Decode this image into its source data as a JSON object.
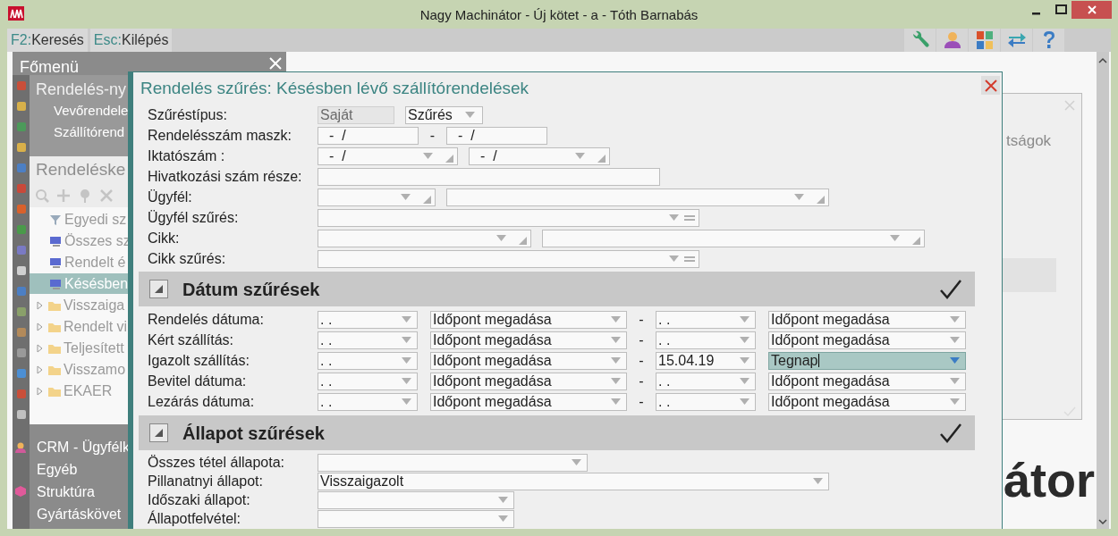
{
  "window": {
    "title": "Nagy Machinátor - Új kötet - a - Tóth Barnabás"
  },
  "toolbar": {
    "shortcuts": [
      {
        "key": "F2:",
        "label": "Keresés"
      },
      {
        "key": "Esc:",
        "label": "Kilépés"
      }
    ]
  },
  "main_menu": {
    "title": "Főmenü",
    "group": "Rendelés-ny",
    "group_items": [
      "Vevőrendele",
      "Szállítórend"
    ],
    "items": [
      "CRM - Ügyfélk",
      "Egyéb",
      "Struktúra",
      "Gyártáskövet"
    ]
  },
  "list_panel": {
    "title": "Rendeléske",
    "items": [
      {
        "label": "Egyedi sz",
        "kind": "filter",
        "selected": false
      },
      {
        "label": "Összes sz",
        "kind": "query",
        "selected": false
      },
      {
        "label": "Rendelt é",
        "kind": "query",
        "selected": false
      },
      {
        "label": "Késésben",
        "kind": "query",
        "selected": true
      },
      {
        "label": "Visszaiga",
        "kind": "folder",
        "selected": false,
        "expanded": false
      },
      {
        "label": "Rendelt vi",
        "kind": "folder",
        "selected": false,
        "expanded": false
      },
      {
        "label": "Teljesített",
        "kind": "folder",
        "selected": false,
        "expanded": false
      },
      {
        "label": "Visszamo",
        "kind": "folder",
        "selected": false,
        "expanded": false
      },
      {
        "label": "EKAER",
        "kind": "folder",
        "selected": false,
        "expanded": false
      }
    ]
  },
  "dialog": {
    "title": "Rendelés szűrés: Késésben lévő szállítórendelések",
    "rows": [
      {
        "label": "Szűréstípus:",
        "fields": [
          {
            "kind": "readonly",
            "value": "Saját"
          },
          {
            "kind": "select",
            "value": "Szűrés"
          }
        ]
      },
      {
        "label": "Rendelésszám maszk:",
        "separator": "-",
        "fields": [
          {
            "kind": "input",
            "value": "-  /"
          },
          {
            "kind": "input",
            "value": "-  /"
          }
        ]
      },
      {
        "label": "Iktatószám :",
        "fields": [
          {
            "kind": "combo",
            "value": "-  /"
          },
          {
            "kind": "combo",
            "value": "-  /"
          }
        ]
      },
      {
        "label": "Hivatkozási szám része:",
        "fields": [
          {
            "kind": "input"
          }
        ]
      },
      {
        "label": "Ügyfél:",
        "fields": [
          {
            "kind": "combo"
          },
          {
            "kind": "combo"
          }
        ]
      },
      {
        "label": "Ügyfél szűrés:",
        "fields": [
          {
            "kind": "filter"
          }
        ]
      },
      {
        "label": "Cikk:",
        "fields": [
          {
            "kind": "combo"
          },
          {
            "kind": "combo"
          }
        ]
      },
      {
        "label": "Cikk szűrés:",
        "fields": [
          {
            "kind": "filter"
          }
        ]
      }
    ],
    "sections": [
      {
        "title": "Dátum szűrések",
        "kind": "date",
        "expanded": true,
        "checked": true,
        "rows": [
          {
            "label": "Rendelés dátuma:",
            "from_date": ". .",
            "from_time": "Időpont megadása",
            "separator": "-",
            "to_date": ". .",
            "to_time": "Időpont megadása",
            "focused": false
          },
          {
            "label": "Kért szállítás:",
            "from_date": ". .",
            "from_time": "Időpont megadása",
            "separator": "-",
            "to_date": ". .",
            "to_time": "Időpont megadása",
            "focused": false
          },
          {
            "label": "Igazolt szállítás:",
            "from_date": ". .",
            "from_time": "Időpont megadása",
            "separator": "-",
            "to_date": "15.04.19",
            "to_time": "Tegnap",
            "focused": true
          },
          {
            "label": "Bevitel dátuma:",
            "from_date": ". .",
            "from_time": "Időpont megadása",
            "separator": "-",
            "to_date": ". .",
            "to_time": "Időpont megadása",
            "focused": false
          },
          {
            "label": "Lezárás dátuma:",
            "from_date": ". .",
            "from_time": "Időpont megadása",
            "separator": "-",
            "to_date": ". .",
            "to_time": "Időpont megadása",
            "focused": false
          }
        ]
      },
      {
        "title": "Állapot szűrések",
        "kind": "status",
        "expanded": true,
        "checked": true,
        "rows": [
          {
            "label": "Összes tétel állapota:"
          },
          {
            "label": "Pillanatnyi állapot:",
            "value": "Visszaigazolt"
          },
          {
            "label": "Időszaki állapot:"
          },
          {
            "label": "Állapotfelvétel:"
          }
        ]
      }
    ]
  },
  "background_window": {
    "text": "tságok",
    "heading": "átor"
  }
}
